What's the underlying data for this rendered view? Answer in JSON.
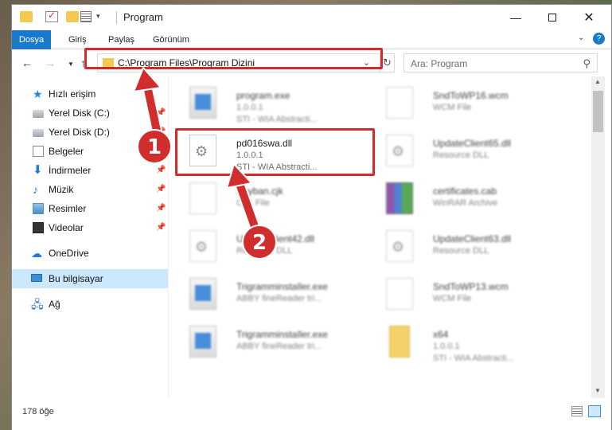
{
  "window": {
    "title": "Program",
    "controls": {
      "minimize": "—",
      "maximize": "",
      "close": "✕"
    }
  },
  "ribbon": {
    "tabs": [
      "Dosya",
      "Giriş",
      "Paylaş",
      "Görünüm"
    ],
    "expand": "⌄",
    "help": "?"
  },
  "nav": {
    "address": "C:\\Program Files\\Program Dizini",
    "search_placeholder": "Ara: Program"
  },
  "sidebar": {
    "items": [
      {
        "label": "Hızlı erişim",
        "icon": "star-icon",
        "pinned": false
      },
      {
        "label": "Yerel Disk (C:)",
        "icon": "disk-icon",
        "pinned": true
      },
      {
        "label": "Yerel Disk (D:)",
        "icon": "disk-icon",
        "pinned": true
      },
      {
        "label": "Belgeler",
        "icon": "documents-icon",
        "pinned": true
      },
      {
        "label": "İndirmeler",
        "icon": "download-icon",
        "pinned": true
      },
      {
        "label": "Müzik",
        "icon": "music-icon",
        "pinned": true
      },
      {
        "label": "Resimler",
        "icon": "pictures-icon",
        "pinned": true
      },
      {
        "label": "Videolar",
        "icon": "videos-icon",
        "pinned": true
      },
      {
        "label": "OneDrive",
        "icon": "cloud-icon",
        "pinned": false
      },
      {
        "label": "Bu bilgisayar",
        "icon": "computer-icon",
        "pinned": false,
        "selected": true
      },
      {
        "label": "Ağ",
        "icon": "network-icon",
        "pinned": false
      }
    ]
  },
  "files": [
    {
      "name": "program.exe",
      "line1": "1.0.0.1",
      "line2": "STI - WIA Abstracti...",
      "type": "exe"
    },
    {
      "name": "SndToWP16.wcm",
      "line1": "WCM File",
      "line2": "",
      "type": "doc"
    },
    {
      "name": "pd016swa.dll",
      "line1": "1.0.0.1",
      "line2": "STI - WIA Abstracti...",
      "type": "dll",
      "highlighted": true
    },
    {
      "name": "UpdateClient65.dll",
      "line1": "Resource DLL",
      "line2": "",
      "type": "dll"
    },
    {
      "name": "Keyban.cjk",
      "line1": "CJK File",
      "line2": "",
      "type": "doc"
    },
    {
      "name": "certificates.cab",
      "line1": "WinRAR Archive",
      "line2": "",
      "type": "cab"
    },
    {
      "name": "UpdateClient42.dll",
      "line1": "Resource DLL",
      "line2": "",
      "type": "dll"
    },
    {
      "name": "UpdateClient63.dll",
      "line1": "Resource DLL",
      "line2": "",
      "type": "dll"
    },
    {
      "name": "TrigramminstaIler.exe",
      "line1": "ABBY fineReader tri...",
      "line2": "",
      "type": "exe"
    },
    {
      "name": "SndToWP13.wcm",
      "line1": "WCM File",
      "line2": "",
      "type": "doc"
    },
    {
      "name": "TrigramminstaIler.exe",
      "line1": "ABBY fineReader tri...",
      "line2": "",
      "type": "exe"
    },
    {
      "name": "x64",
      "line1": "1.0.0.1",
      "line2": "STI - WIA Abstracti...",
      "type": "folder"
    }
  ],
  "status": {
    "count": "178 öğe"
  },
  "annotations": {
    "badge1": "1",
    "badge2": "2",
    "color": "#d12d2d"
  }
}
